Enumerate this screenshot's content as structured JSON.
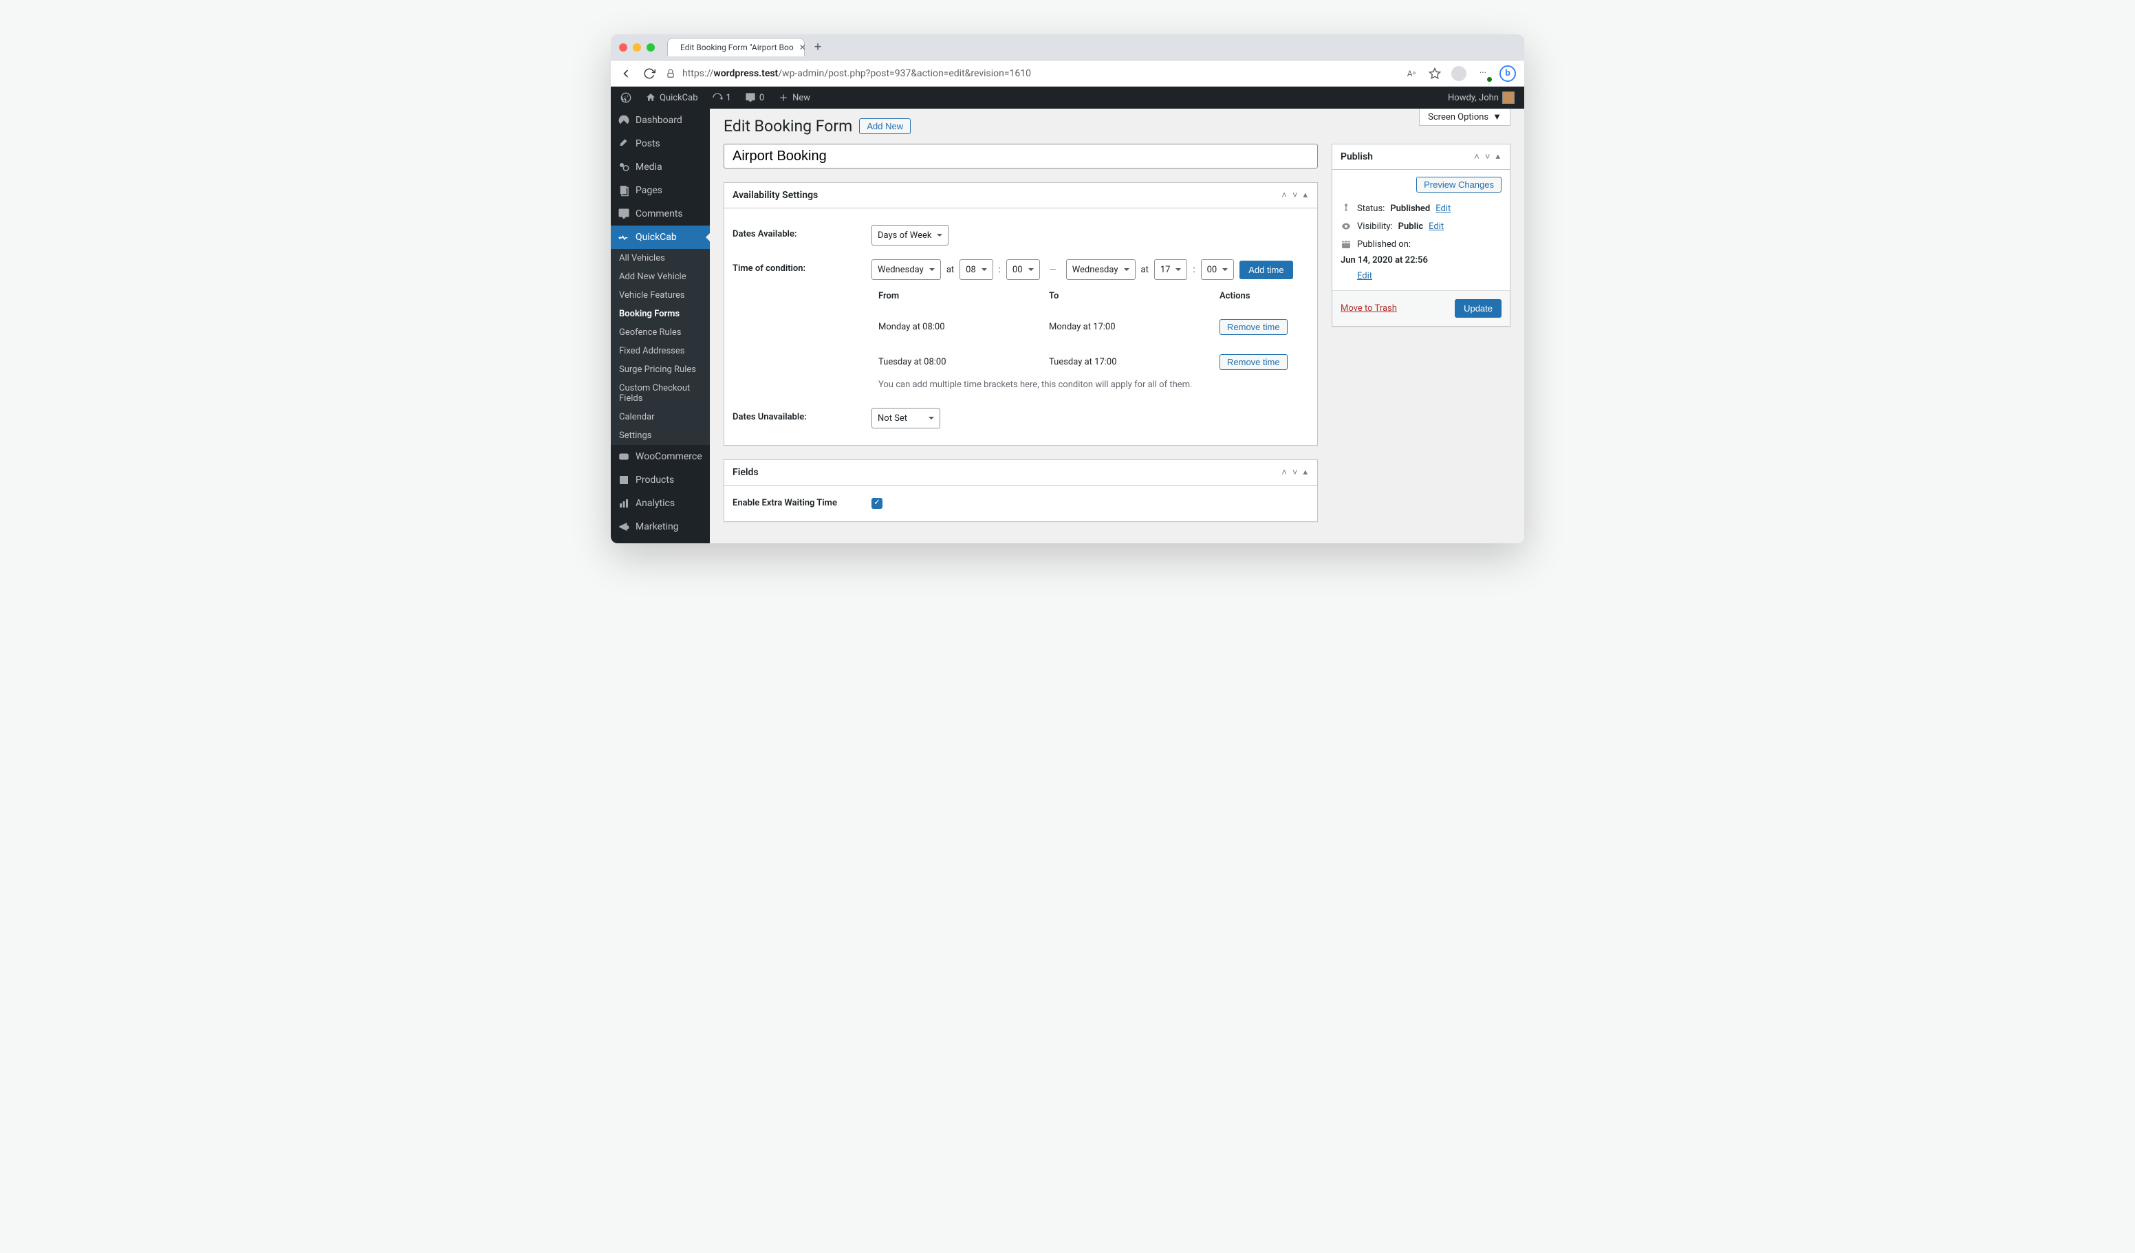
{
  "browser": {
    "tab_title": "Edit Booking Form \"Airport Boo",
    "url_prefix": "https://",
    "url_host": "wordpress.test",
    "url_path": "/wp-admin/post.php?post=937&action=edit&revision=1610"
  },
  "adminbar": {
    "site_name": "QuickCab",
    "updates_count": "1",
    "comments_count": "0",
    "new_label": "New",
    "howdy": "Howdy, John"
  },
  "sidebar": {
    "items": [
      {
        "label": "Dashboard"
      },
      {
        "label": "Posts"
      },
      {
        "label": "Media"
      },
      {
        "label": "Pages"
      },
      {
        "label": "Comments"
      },
      {
        "label": "QuickCab",
        "active": true
      },
      {
        "label": "WooCommerce"
      },
      {
        "label": "Products"
      },
      {
        "label": "Analytics"
      },
      {
        "label": "Marketing"
      }
    ],
    "submenu": [
      {
        "label": "All Vehicles"
      },
      {
        "label": "Add New Vehicle"
      },
      {
        "label": "Vehicle Features"
      },
      {
        "label": "Booking Forms",
        "active": true
      },
      {
        "label": "Geofence Rules"
      },
      {
        "label": "Fixed Addresses"
      },
      {
        "label": "Surge Pricing Rules"
      },
      {
        "label": "Custom Checkout Fields"
      },
      {
        "label": "Calendar"
      },
      {
        "label": "Settings"
      }
    ]
  },
  "page": {
    "screen_options": "Screen Options",
    "heading": "Edit Booking Form",
    "add_new": "Add New",
    "title_value": "Airport Booking"
  },
  "availability": {
    "panel_title": "Availability Settings",
    "dates_available_label": "Dates Available:",
    "dates_available_value": "Days of Week",
    "time_label": "Time of condition:",
    "from_day": "Wednesday",
    "at_text": "at",
    "from_hour": "08",
    "from_min": "00",
    "to_day": "Wednesday",
    "to_hour": "17",
    "to_min": "00",
    "colon": ":",
    "dash": "—",
    "add_time": "Add time",
    "col_from": "From",
    "col_to": "To",
    "col_actions": "Actions",
    "rows": [
      {
        "from": "Monday at 08:00",
        "to": "Monday at 17:00",
        "action": "Remove time"
      },
      {
        "from": "Tuesday at 08:00",
        "to": "Tuesday at 17:00",
        "action": "Remove time"
      }
    ],
    "hint": "You can add multiple time brackets here, this conditon will apply for all of them.",
    "dates_unavailable_label": "Dates Unavailable:",
    "dates_unavailable_value": "Not Set"
  },
  "fields_panel": {
    "title": "Fields",
    "waiting_label": "Enable Extra Waiting Time"
  },
  "publish": {
    "panel_title": "Publish",
    "preview": "Preview Changes",
    "status_label": "Status:",
    "status_value": "Published",
    "visibility_label": "Visibility:",
    "visibility_value": "Public",
    "published_label": "Published on:",
    "published_value": "Jun 14, 2020 at 22:56",
    "edit": "Edit",
    "trash": "Move to Trash",
    "update": "Update"
  }
}
